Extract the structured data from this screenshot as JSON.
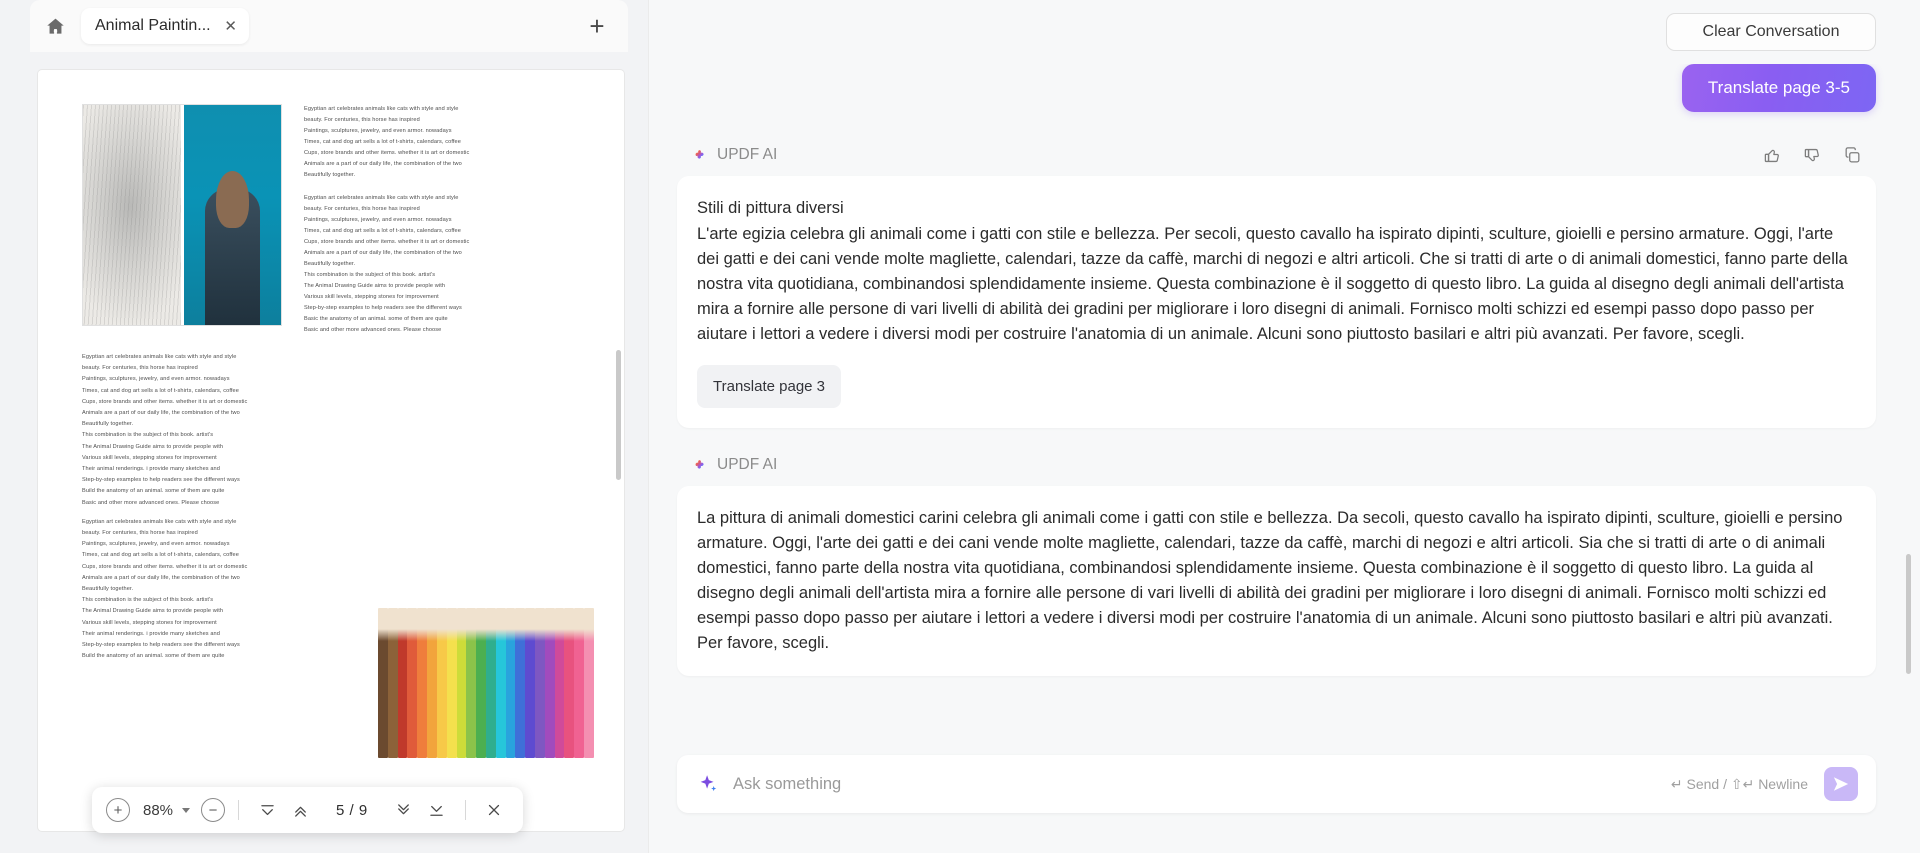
{
  "window": {
    "home_icon": "home-icon",
    "new_tab_icon": "plus-icon",
    "tab": {
      "title": "Animal Paintin...",
      "close_icon": "close-icon"
    }
  },
  "pdf": {
    "lines_right_col": [
      "Egyptian art celebrates animals like cats with style and style",
      "beauty. For centuries, this horse has inspired",
      "Paintings, sculptures, jewelry, and even armor. nowadays",
      "Times, cat and dog art sells a lot of t-shirts, calendars, coffee",
      "Cups, store brands and other items. whether it is art or domestic",
      "Animals are a part of our daily life, the combination of the two",
      "Beautifully together."
    ],
    "lines_right_col_2": [
      "Egyptian art celebrates animals like cats with style and style",
      "beauty. For centuries, this horse has inspired",
      "Paintings, sculptures, jewelry, and even armor. nowadays",
      "Times, cat and dog art sells a lot of t-shirts, calendars, coffee",
      "Cups, store brands and other items. whether it is art or domestic",
      "Animals are a part of our daily life, the combination of the two",
      "Beautifully together.",
      "This combination is the subject of this book. artist's",
      "The Animal Drawing Guide aims to provide people with",
      "Various skill levels, stepping stones for improvement",
      "Step-by-step examples to help readers see the different ways",
      "Basic the anatomy of an animal. some of them are quite",
      "Basic and other more advanced ones. Please choose"
    ],
    "lines_lower": [
      "Egyptian art celebrates animals like cats with style and style",
      "beauty. For centuries, this horse has inspired",
      "Paintings, sculptures, jewelry, and even armor. nowadays",
      "Times, cat and dog art sells a lot of t-shirts, calendars, coffee",
      "Cups, store brands and other items. whether it is art or domestic",
      "Animals are a part of our daily life, the combination of the two",
      "Beautifully together.",
      "This combination is the subject of this book. artist's",
      "The Animal Drawing Guide aims to provide people with",
      "Various skill levels, stepping stones for improvement",
      "Their animal renderings. i provide many sketches and",
      "Step-by-step examples to help readers see the different ways",
      "Build the anatomy of an animal. some of them are quite",
      "Basic and other more advanced ones. Please choose"
    ],
    "lines_lower_2": [
      "Egyptian art celebrates animals like cats with style and style",
      "beauty. For centuries, this horse has inspired",
      "Paintings, sculptures, jewelry, and even armor. nowadays",
      "Times, cat and dog art sells a lot of t-shirts, calendars, coffee",
      "Cups, store brands and other items. whether it is art or domestic",
      "Animals are a part of our daily life, the combination of the two",
      "Beautifully together.",
      "This combination is the subject of this book. artist's",
      "The Animal Drawing Guide aims to provide people with",
      "Various skill levels, stepping stones for improvement",
      "Their animal renderings. i provide many sketches and",
      "Step-by-step examples to help readers see the different ways",
      "Build the anatomy of an animal. some of them are quite"
    ],
    "toolbar": {
      "zoom_in_icon": "plus-circle-icon",
      "zoom_level": "88%",
      "zoom_caret_icon": "chevron-down-icon",
      "zoom_out_icon": "minus-circle-icon",
      "first_page_icon": "go-to-first-page-icon",
      "prev_page_icon": "previous-page-icon",
      "page_indicator": "5 / 9",
      "next_page_icon": "next-page-icon",
      "last_page_icon": "go-to-last-page-icon",
      "close_icon": "close-icon"
    }
  },
  "ai": {
    "clear_label": "Clear Conversation",
    "user_message": "Translate page 3-5",
    "messages": [
      {
        "author": "UPDF AI",
        "logo_icon": "updf-logo-icon",
        "actions": [
          "thumbs-up-icon",
          "thumbs-down-icon",
          "copy-icon"
        ],
        "head": "Stili di pittura diversi",
        "body": "L'arte egizia celebra gli animali come i gatti con stile e bellezza. Per secoli, questo cavallo ha ispirato dipinti, sculture, gioielli e persino armature. Oggi, l'arte dei gatti e dei cani vende molte magliette, calendari, tazze da caffè, marchi di negozi e altri articoli. Che si tratti di arte o di animali domestici, fanno parte della nostra vita quotidiana, combinandosi splendidamente insieme. Questa combinazione è il soggetto di questo libro. La guida al disegno degli animali dell'artista mira a fornire alle persone di vari livelli di abilità dei gradini per migliorare i loro disegni di animali. Fornisco molti schizzi ed esempi passo dopo passo per aiutare i lettori a vedere i diversi modi per costruire l'anatomia di un animale. Alcuni sono piuttosto basilari e altri più avanzati. Per favore, scegli.",
        "suggestion": "Translate page 3"
      },
      {
        "author": "UPDF AI",
        "logo_icon": "updf-logo-icon",
        "head": "",
        "body": "La pittura di animali domestici carini celebra gli animali come i gatti con stile e bellezza. Da secoli, questo cavallo ha ispirato dipinti, sculture, gioielli e persino armature. Oggi, l'arte dei gatti e dei cani vende molte magliette, calendari, tazze da caffè, marchi di negozi e altri articoli. Sia che si tratti di arte o di animali domestici, fanno parte della nostra vita quotidiana, combinandosi splendidamente insieme. Questa combinazione è il soggetto di questo libro. La guida al disegno degli animali dell'artista mira a fornire alle persone di vari livelli di abilità dei gradini per migliorare i loro disegni di animali. Fornisco molti schizzi ed esempi passo dopo passo per aiutare i lettori a vedere i diversi modi per costruire l'anatomia di un animale. Alcuni sono piuttosto basilari e altri più avanzati. Per favore, scegli.",
        "suggestion": ""
      }
    ],
    "composer": {
      "spark_icon": "ai-sparkle-icon",
      "placeholder": "Ask something",
      "hint": "↵ Send  /  ⇧↵ Newline",
      "send_icon": "send-icon"
    }
  },
  "colors": {
    "accent_purple": "#8a5ef2",
    "panel_bg": "#f7f8f9",
    "bubble_bg": "#ffffff"
  }
}
